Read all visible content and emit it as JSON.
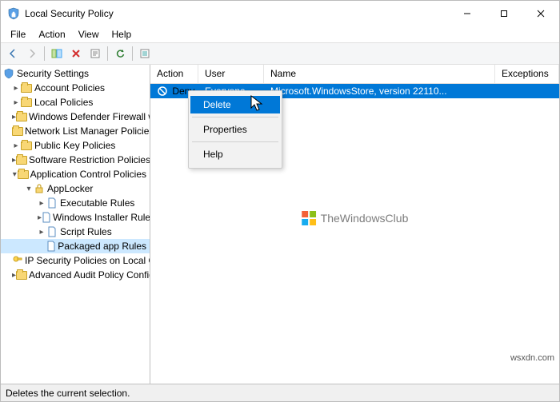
{
  "titlebar": {
    "title": "Local Security Policy"
  },
  "menubar": {
    "file": "File",
    "action": "Action",
    "view": "View",
    "help": "Help"
  },
  "tree": {
    "root": "Security Settings",
    "items": [
      "Account Policies",
      "Local Policies",
      "Windows Defender Firewall with Advanced Security",
      "Network List Manager Policies",
      "Public Key Policies",
      "Software Restriction Policies",
      "Application Control Policies",
      "IP Security Policies on Local Computer",
      "Advanced Audit Policy Configuration"
    ],
    "applocker": "AppLocker",
    "applocker_children": [
      "Executable Rules",
      "Windows Installer Rules",
      "Script Rules",
      "Packaged app Rules"
    ]
  },
  "list": {
    "headers": {
      "action": "Action",
      "user": "User",
      "name": "Name",
      "exceptions": "Exceptions"
    },
    "row": {
      "action": "Deny",
      "user": "Everyone",
      "name": "Microsoft.WindowsStore, version 22110...",
      "exceptions": ""
    }
  },
  "context_menu": {
    "delete": "Delete",
    "properties": "Properties",
    "help": "Help"
  },
  "watermark": "TheWindowsClub",
  "statusbar": "Deletes the current selection.",
  "credit": "wsxdn.com"
}
